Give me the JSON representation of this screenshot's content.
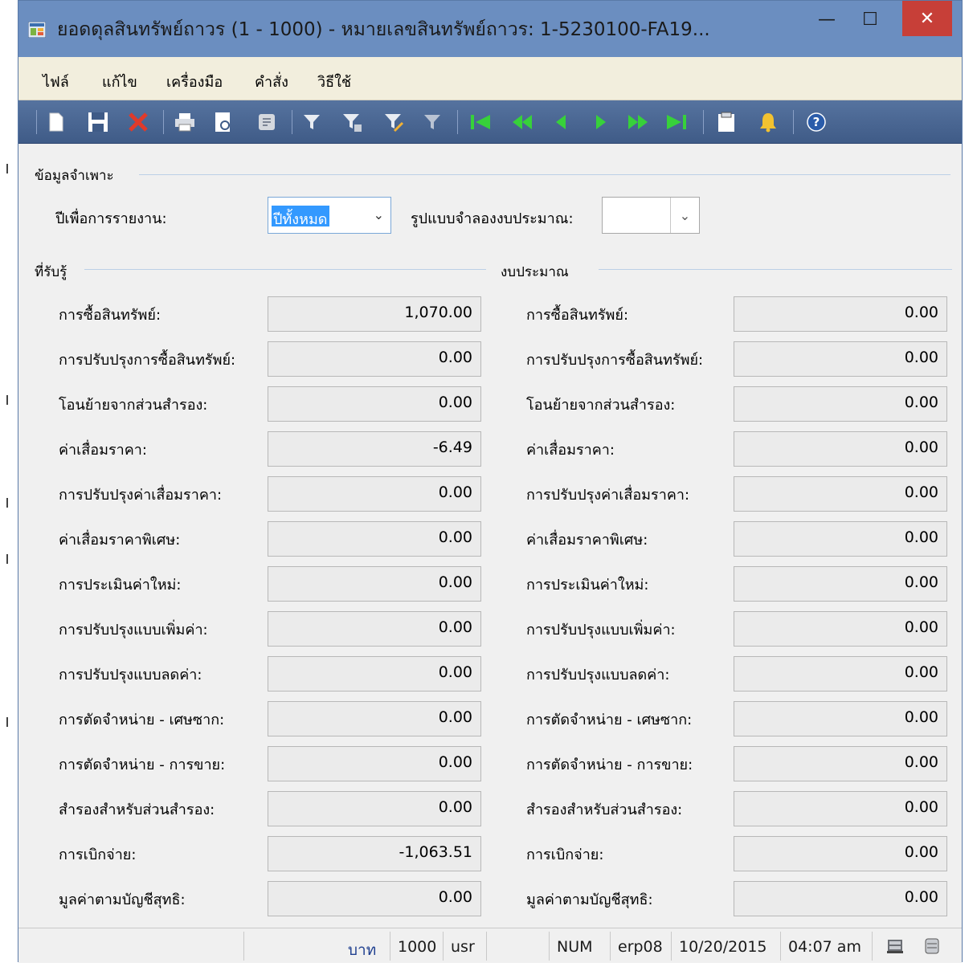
{
  "window": {
    "title": "ยอดดุลสินทรัพย์ถาวร (1 - 1000) - หมายเลขสินทรัพย์ถาวร: 1-5230100-FA19...",
    "minimize": "—",
    "maximize": "☐",
    "close": "✕"
  },
  "menu": [
    "ไฟล์",
    "แก้ไข",
    "เครื่องมือ",
    "คำสั่ง",
    "วิธีใช้"
  ],
  "specific": {
    "group_title": "ข้อมูลจำเพาะ",
    "year_label": "ปีเพื่อการรายงาน:",
    "year_value": "ปีทั้งหมด",
    "budget_model_label": "รูปแบบจำลองงบประมาณ:",
    "budget_model_value": ""
  },
  "received": {
    "group_title": "ที่รับรู้",
    "rows": [
      {
        "label": "การซื้อสินทรัพย์:",
        "value": "1,070.00"
      },
      {
        "label": "การปรับปรุงการซื้อสินทรัพย์:",
        "value": "0.00"
      },
      {
        "label": "โอนย้ายจากส่วนสำรอง:",
        "value": "0.00"
      },
      {
        "label": "ค่าเสื่อมราคา:",
        "value": "-6.49"
      },
      {
        "label": "การปรับปรุงค่าเสื่อมราคา:",
        "value": "0.00"
      },
      {
        "label": "ค่าเสื่อมราคาพิเศษ:",
        "value": "0.00"
      },
      {
        "label": "การประเมินค่าใหม่:",
        "value": "0.00"
      },
      {
        "label": "การปรับปรุงแบบเพิ่มค่า:",
        "value": "0.00"
      },
      {
        "label": "การปรับปรุงแบบลดค่า:",
        "value": "0.00"
      },
      {
        "label": "การตัดจำหน่าย - เศษซาก:",
        "value": "0.00"
      },
      {
        "label": "การตัดจำหน่าย - การขาย:",
        "value": "0.00"
      },
      {
        "label": "สำรองสำหรับส่วนสำรอง:",
        "value": "0.00"
      },
      {
        "label": "การเบิกจ่าย:",
        "value": "-1,063.51"
      },
      {
        "label": "มูลค่าตามบัญชีสุทธิ:",
        "value": "0.00"
      }
    ]
  },
  "budget": {
    "group_title": "งบประมาณ",
    "rows": [
      {
        "label": "การซื้อสินทรัพย์:",
        "value": "0.00"
      },
      {
        "label": "การปรับปรุงการซื้อสินทรัพย์:",
        "value": "0.00"
      },
      {
        "label": "โอนย้ายจากส่วนสำรอง:",
        "value": "0.00"
      },
      {
        "label": "ค่าเสื่อมราคา:",
        "value": "0.00"
      },
      {
        "label": "การปรับปรุงค่าเสื่อมราคา:",
        "value": "0.00"
      },
      {
        "label": "ค่าเสื่อมราคาพิเศษ:",
        "value": "0.00"
      },
      {
        "label": "การประเมินค่าใหม่:",
        "value": "0.00"
      },
      {
        "label": "การปรับปรุงแบบเพิ่มค่า:",
        "value": "0.00"
      },
      {
        "label": "การปรับปรุงแบบลดค่า:",
        "value": "0.00"
      },
      {
        "label": "การตัดจำหน่าย - เศษซาก:",
        "value": "0.00"
      },
      {
        "label": "การตัดจำหน่าย - การขาย:",
        "value": "0.00"
      },
      {
        "label": "สำรองสำหรับส่วนสำรอง:",
        "value": "0.00"
      },
      {
        "label": "การเบิกจ่าย:",
        "value": "0.00"
      },
      {
        "label": "มูลค่าตามบัญชีสุทธิ:",
        "value": "0.00"
      }
    ]
  },
  "status": {
    "currency": "บาท",
    "company": "1000",
    "user": "usr",
    "num": "NUM",
    "server": "erp08",
    "date": "10/20/2015",
    "time": "04:07 am"
  },
  "colors": {
    "titlebar": "#6b8ec0",
    "toolbar": "#4a6694",
    "close_button": "#c73f38",
    "selection": "#3399ff",
    "currency_text": "#1f3f8f"
  },
  "toolbar_icons": [
    "new-icon",
    "save-icon",
    "delete-icon",
    "print-icon",
    "print-preview-icon",
    "export-icon",
    "filter-icon",
    "filter-by-selection-icon",
    "advanced-filter-icon",
    "remove-filter-icon",
    "first-record-icon",
    "previous-page-icon",
    "previous-record-icon",
    "next-record-icon",
    "next-page-icon",
    "last-record-icon",
    "document-handling-icon",
    "alert-icon",
    "help-icon"
  ]
}
